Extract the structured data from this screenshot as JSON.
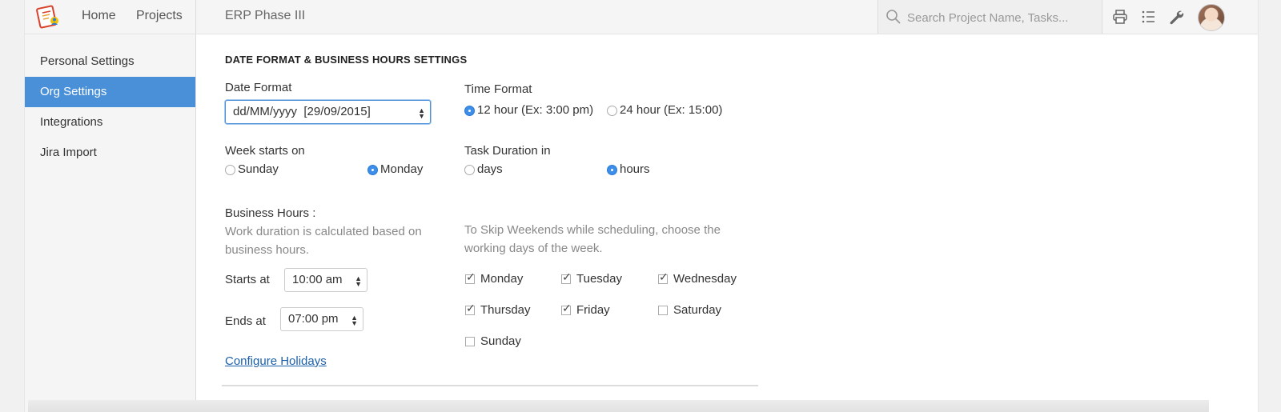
{
  "header": {
    "nav": [
      "Home",
      "Projects"
    ],
    "project_name": "ERP Phase III",
    "search_placeholder": "Search Project Name, Tasks..."
  },
  "sidebar": {
    "items": [
      {
        "label": "Personal Settings",
        "active": false
      },
      {
        "label": "Org Settings",
        "active": true
      },
      {
        "label": "Integrations",
        "active": false
      },
      {
        "label": "Jira Import",
        "active": false
      }
    ]
  },
  "main": {
    "title": "DATE FORMAT & BUSINESS HOURS SETTINGS",
    "date_format": {
      "label": "Date Format",
      "value": "dd/MM/yyyy  [29/09/2015]"
    },
    "time_format": {
      "label": "Time Format",
      "options": [
        "12 hour (Ex: 3:00 pm)",
        "24 hour (Ex: 15:00)"
      ],
      "selected": "12 hour (Ex: 3:00 pm)"
    },
    "week_start": {
      "label": "Week starts on",
      "options": [
        "Sunday",
        "Monday"
      ],
      "selected": "Monday"
    },
    "task_duration": {
      "label": "Task Duration in",
      "options": [
        "days",
        "hours"
      ],
      "selected": "hours"
    },
    "business_hours": {
      "label": "Business Hours :",
      "description_line1": "Work duration is calculated based on",
      "description_line2": "business hours.",
      "starts_label": "Starts at",
      "starts_value": "10:00 am",
      "ends_label": "Ends at",
      "ends_value": "07:00 pm"
    },
    "weekend_note_line1": "To Skip Weekends while scheduling, choose the",
    "weekend_note_line2": "working days of the week.",
    "working_days": [
      {
        "day": "Monday",
        "checked": true
      },
      {
        "day": "Tuesday",
        "checked": true
      },
      {
        "day": "Wednesday",
        "checked": true
      },
      {
        "day": "Thursday",
        "checked": true
      },
      {
        "day": "Friday",
        "checked": true
      },
      {
        "day": "Saturday",
        "checked": false
      },
      {
        "day": "Sunday",
        "checked": false
      }
    ],
    "configure_holidays": "Configure Holidays"
  },
  "icons": [
    "app-logo-icon",
    "search-icon",
    "print-icon",
    "list-icon",
    "wrench-icon"
  ],
  "colors": {
    "accent": "#4a90d9",
    "link": "#1a5fa8",
    "radio_on": "#3d8ee8"
  }
}
